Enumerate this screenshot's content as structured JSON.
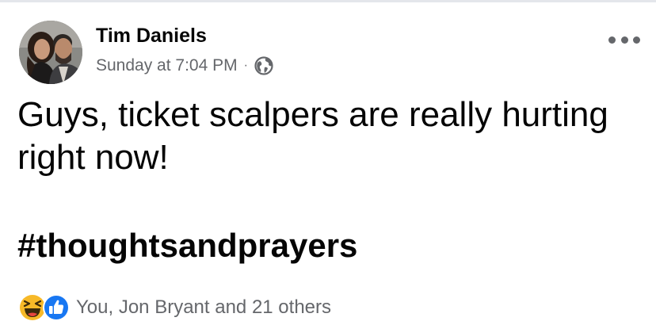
{
  "post": {
    "author": "Tim Daniels",
    "timestamp": "Sunday at 7:04 PM",
    "separator": "·",
    "audience_icon": "globe-icon",
    "more_icon": "more-options-icon",
    "text": "Guys, ticket scalpers are really hurting right now!",
    "hashtag": "#thoughtsandprayers"
  },
  "reactions": {
    "icons": [
      "haha-icon",
      "like-icon"
    ],
    "summary": "You, Jon Bryant and 21 others"
  },
  "colors": {
    "text_primary": "#050505",
    "text_secondary": "#65676b",
    "like_blue": "#1877f2",
    "haha_yellow": "#f7b928"
  }
}
